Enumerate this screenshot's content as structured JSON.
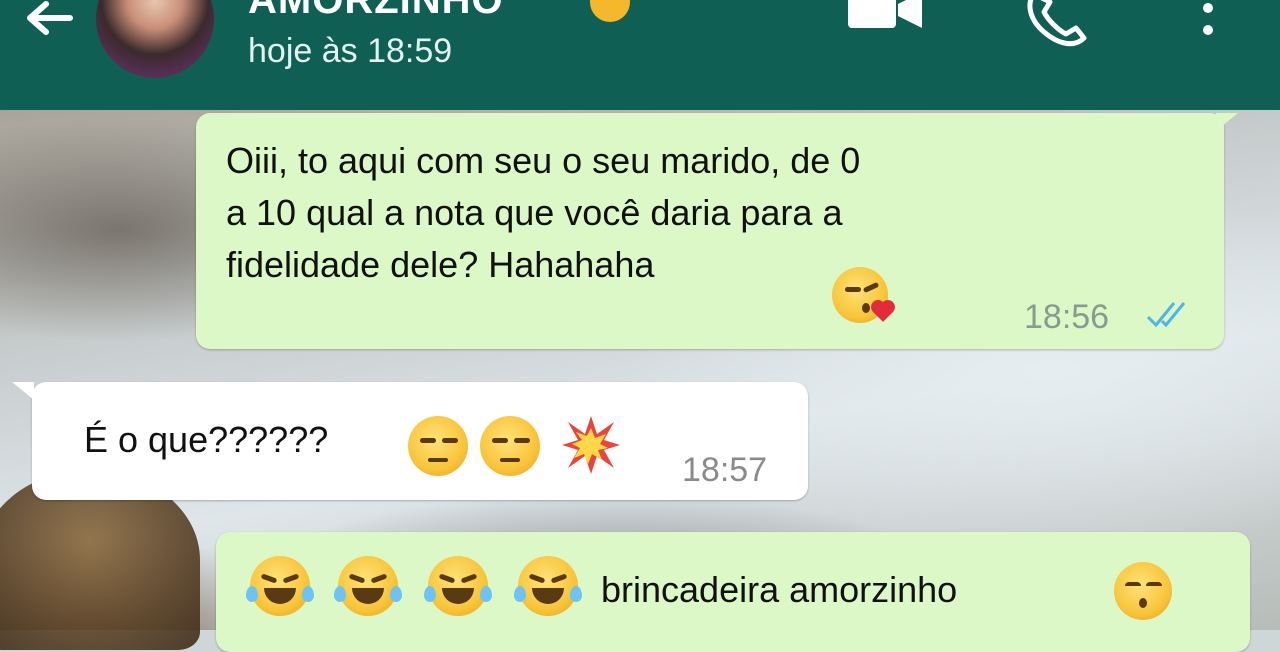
{
  "header": {
    "contact_name": "AMORZINHO",
    "last_seen": "hoje às 18:59",
    "icons": [
      "back-arrow-icon",
      "video-call-icon",
      "phone-icon",
      "menu-dots-icon"
    ],
    "colors": {
      "bar": "#0f5f54",
      "text": "#ffffff"
    }
  },
  "messages": [
    {
      "direction": "outgoing",
      "lines": [
        "Oiii, to aqui com seu o seu marido, de 0",
        "a 10 qual a nota que você daria para a",
        "fidelidade dele? Hahahaha"
      ],
      "emojis": [
        "face-throwing-kiss"
      ],
      "time": "18:56",
      "status": "read-double-check"
    },
    {
      "direction": "incoming",
      "text": "É o que??????",
      "emojis": [
        "unamused-face",
        "unamused-face",
        "collision"
      ],
      "time": "18:57"
    },
    {
      "direction": "outgoing",
      "text": "brincadeira amorzinho",
      "leading_emojis": [
        "face-with-tears-of-joy",
        "face-with-tears-of-joy",
        "face-with-tears-of-joy",
        "face-with-tears-of-joy"
      ],
      "trailing_emojis": [
        "kissing-face-smiling-eyes"
      ]
    }
  ],
  "colors": {
    "outgoing_bubble": "#dcf8c6",
    "incoming_bubble": "#ffffff",
    "read_ticks": "#4fb4e8"
  }
}
